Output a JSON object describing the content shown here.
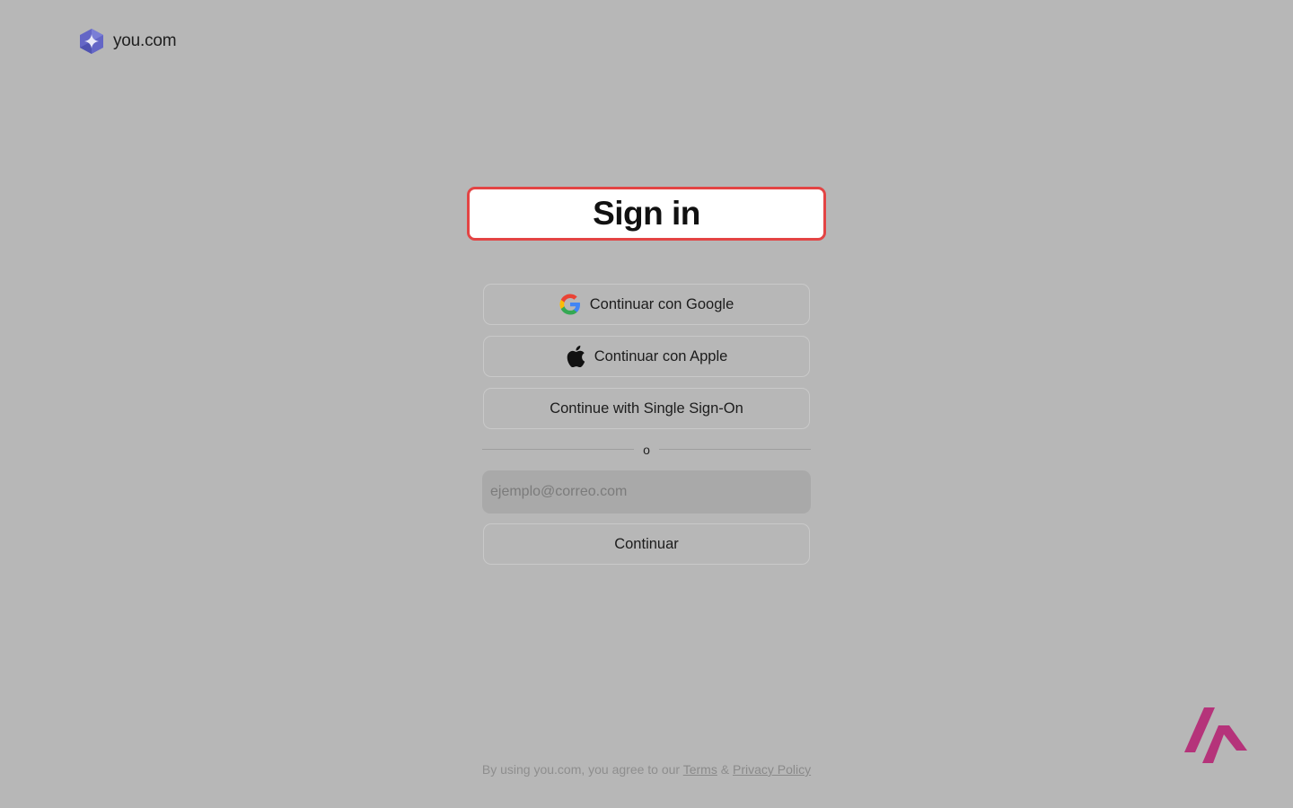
{
  "brand": {
    "name": "you.com",
    "logo_icon": "you-com-logo-icon",
    "accent": "#5b5fc7"
  },
  "title": "Sign in",
  "auth": {
    "google_label": "Continuar con Google",
    "apple_label": "Continuar con Apple",
    "sso_label": "Continue with Single Sign-On",
    "divider_label": "o",
    "email_placeholder": "ejemplo@correo.com",
    "email_value": "",
    "continue_label": "Continuar"
  },
  "footer": {
    "prefix": "By using you.com, you agree to our",
    "terms_label": "Terms",
    "separator": "&",
    "privacy_label": "Privacy Policy"
  },
  "colors": {
    "background": "#b7b7b7",
    "highlight_border": "#e34444",
    "corner_logo": "#b5337a"
  }
}
